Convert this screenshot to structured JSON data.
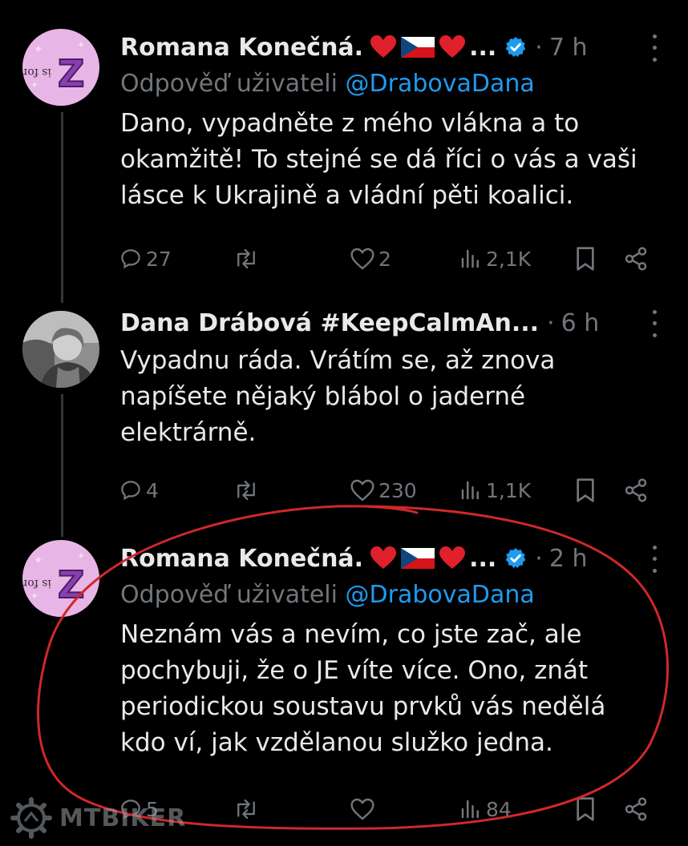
{
  "tweets": [
    {
      "name": "Romana Konečná.",
      "ellipsis": "...",
      "dot": "·",
      "time": "7 h",
      "reply_prefix": "Odpověď uživateli",
      "reply_handle": "@DrabovaDana",
      "lines": [
        "Dano, vypadněte z mého vlákna a to",
        "okamžitě! To stejné se dá říci o vás a vaši",
        "lásce k Ukrajině a vládní pěti koalici."
      ],
      "replies": "27",
      "reposts": "",
      "likes": "2",
      "views": "2,1K"
    },
    {
      "name": "Dana Drábová #KeepCalmAn...",
      "dot": "·",
      "time": "6 h",
      "lines": [
        "Vypadnu ráda. Vrátím se, až znova",
        "napíšete nějaký blábol o jaderné",
        "elektrárně."
      ],
      "replies": "4",
      "reposts": "",
      "likes": "230",
      "views": "1,1K"
    },
    {
      "name": "Romana Konečná.",
      "ellipsis": "...",
      "dot": "·",
      "time": "2 h",
      "reply_prefix": "Odpověď uživateli",
      "reply_handle": "@DrabovaDana",
      "lines": [
        "Neznám vás a nevím, co jste zač, ale",
        "pochybuji, že o JE víte více. Ono, znát",
        "periodickou soustavu prvků vás nedělá",
        "kdo ví, jak vzdělanou služko jedna."
      ],
      "replies": "5",
      "reposts": "",
      "likes": "",
      "views": "84"
    }
  ],
  "watermark": "MTBIKER",
  "colors": {
    "background": "#000000",
    "text": "#e7e9ea",
    "muted": "#71767b",
    "link": "#1d9bf0",
    "annotation": "#d0282a"
  }
}
